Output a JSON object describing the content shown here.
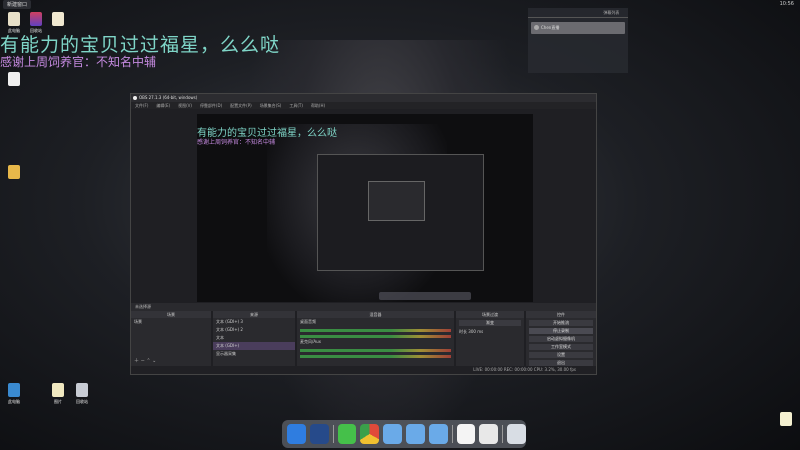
{
  "topbar": {
    "title": "新建窗口",
    "status": [
      "",
      "",
      ""
    ],
    "time": "10:56"
  },
  "desktop_icons": [
    {
      "id": "pc",
      "label": "此电脑"
    },
    {
      "id": "trash-top",
      "label": "回收站"
    },
    {
      "id": "doc1",
      "label": ""
    },
    {
      "id": "doc2",
      "label": ""
    },
    {
      "id": "doc3",
      "label": ""
    },
    {
      "id": "doc4",
      "label": ""
    },
    {
      "id": "folder",
      "label": ""
    },
    {
      "id": "network",
      "label": "此电脑"
    },
    {
      "id": "doc5",
      "label": "图片"
    },
    {
      "id": "recycle",
      "label": "回收站"
    },
    {
      "id": "note",
      "label": ""
    }
  ],
  "overlay": {
    "line1": "有能力的宝贝过过福星，么么哒",
    "line2": "感谢上周饲养官：不知名中辅"
  },
  "chat": {
    "tabs": [
      "",
      "",
      "弹幕列表"
    ],
    "item": "Chen直播"
  },
  "info_panel": {
    "lines_a": [
      "",
      "",
      "",
      ""
    ],
    "lines_b": [
      "",
      "",
      ""
    ]
  },
  "obs": {
    "title": "OBS 27.1.3 (64-bit, windows)",
    "menu": [
      "文件(F)",
      "编辑(E)",
      "视图(V)",
      "停靠部件(D)",
      "配置文件(P)",
      "场景集合(S)",
      "工具(T)",
      "帮助(H)"
    ],
    "preview_status": "未选择源",
    "docks": {
      "scenes": {
        "title": "场景",
        "items": [
          "场景"
        ]
      },
      "sources": {
        "title": "来源",
        "items": [
          "文本 (GDI+) 3",
          "文本 (GDI+) 2",
          "文本",
          "文本 (GDI+)",
          "显示器采集"
        ]
      },
      "mixer": {
        "title": "混音器",
        "tracks": [
          "桌面音频",
          "麦克风/Aux"
        ]
      },
      "transitions": {
        "title": "场景过渡",
        "type": "渐变",
        "duration_label": "时长",
        "duration": "300 ms"
      },
      "controls": {
        "title": "控件",
        "buttons": [
          "开始推流",
          "停止录制",
          "启动虚拟摄像机",
          "工作室模式",
          "设置",
          "退出"
        ]
      }
    },
    "statusbar": "LIVE: 00:00:00   REC: 00:00:00   CPU: 3.2%, 30.00 fps"
  },
  "dock_apps": [
    "finder",
    "launchpad",
    "messages",
    "chrome",
    "folder",
    "folder",
    "folder",
    "calendar",
    "clock",
    "trash"
  ],
  "preview_overlay": {
    "line1": "有能力的宝贝过过福星，么么哒",
    "line2": "感谢上周饲养官：不知名中辅"
  }
}
